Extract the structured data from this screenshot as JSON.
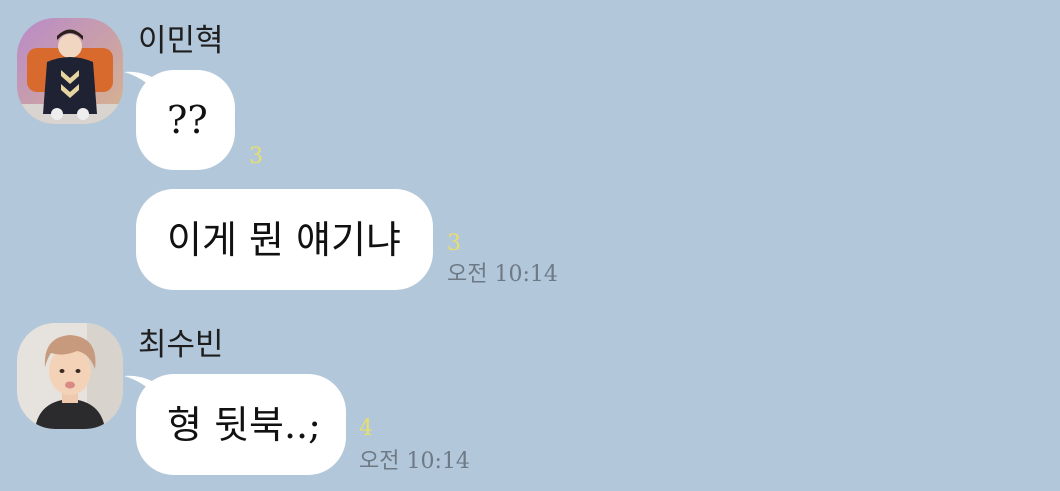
{
  "colors": {
    "background": "#b2c7da",
    "bubble": "#ffffff",
    "unread": "#e8df6a",
    "time": "#6d7a86"
  },
  "chat": {
    "groups": [
      {
        "sender": "이민혁",
        "avatar": "profile-photo",
        "messages": [
          {
            "text": "??",
            "unread": "3",
            "time": ""
          },
          {
            "text": "이게 뭔 얘기냐",
            "unread": "3",
            "time": "오전 10:14"
          }
        ]
      },
      {
        "sender": "최수빈",
        "avatar": "profile-photo",
        "messages": [
          {
            "text": "형 뒷북..;",
            "unread": "4",
            "time": "오전 10:14"
          }
        ]
      }
    ]
  }
}
